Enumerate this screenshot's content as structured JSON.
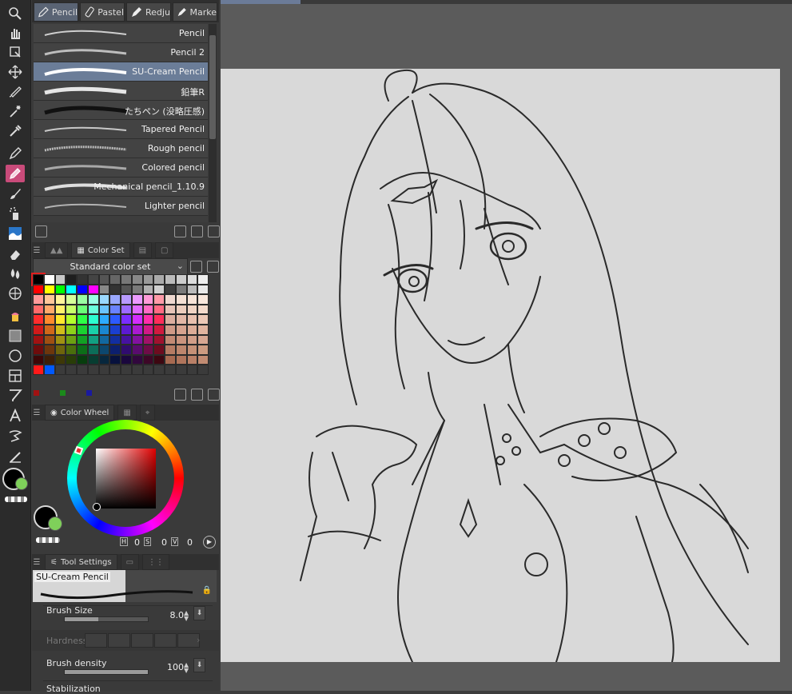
{
  "brush_tabs": [
    {
      "label": "Pencil",
      "selected": true
    },
    {
      "label": "Pastel",
      "selected": false
    },
    {
      "label": "Redju",
      "selected": false
    },
    {
      "label": "Marke",
      "selected": false
    }
  ],
  "brushes": [
    {
      "name": "Pencil",
      "selected": false
    },
    {
      "name": "Pencil 2",
      "selected": false
    },
    {
      "name": "SU-Cream Pencil",
      "selected": true
    },
    {
      "name": "鉛筆R",
      "selected": false
    },
    {
      "name": "たちペン (没略圧感)",
      "selected": false
    },
    {
      "name": "Tapered Pencil",
      "selected": false
    },
    {
      "name": "Rough pencil",
      "selected": false
    },
    {
      "name": "Colored pencil",
      "selected": false
    },
    {
      "name": "Mechanical pencil_1.10.9",
      "selected": false
    },
    {
      "name": "Lighter pencil",
      "selected": false
    }
  ],
  "color_set": {
    "tab_label": "Color Set",
    "selected_set": "Standard color set",
    "colors": [
      "#000000",
      "#ffffff",
      "#c8c8c8",
      "#1e1e1e",
      "#333333",
      "#444444",
      "#555555",
      "#666666",
      "#777777",
      "#888888",
      "#999999",
      "#aaaaaa",
      "#bbbbbb",
      "#cccccc",
      "#dddddd",
      "#eeeeee",
      "#ff0000",
      "#ffff00",
      "#00ff00",
      "#00ffff",
      "#0000ff",
      "#ff00ff",
      "#888888",
      "#333333",
      "#555555",
      "#7a7a7a",
      "#b0b0b0",
      "#d0d0d0",
      "#3e3e3e",
      "#7a7a7a",
      "#bbbbbb",
      "#e8e8e8",
      "#ff9a9a",
      "#ffc79a",
      "#fff59a",
      "#d6ff9a",
      "#9affa2",
      "#9affe4",
      "#9ad8ff",
      "#9aa8ff",
      "#b89aff",
      "#eb9aff",
      "#ff9ad8",
      "#ff9aa8",
      "#efd8d0",
      "#f4e0d4",
      "#f7e4d8",
      "#f8e7dc",
      "#ff6a6a",
      "#ffa96a",
      "#fff06a",
      "#c7ff6a",
      "#6aff78",
      "#6affdb",
      "#6ac4ff",
      "#6a82ff",
      "#9c6aff",
      "#e16aff",
      "#ff6ac4",
      "#ff6a82",
      "#e7c4b8",
      "#eccdbd",
      "#f0d4c4",
      "#f3dacb",
      "#ff2d2d",
      "#ff8a2d",
      "#ffe82d",
      "#b3ff2d",
      "#2dff47",
      "#2dffd0",
      "#2dabff",
      "#2d5aff",
      "#7a2dff",
      "#d32dff",
      "#ff2dab",
      "#ff2d5a",
      "#dcae9f",
      "#e2b7a6",
      "#e8c0ae",
      "#ecc8b6",
      "#d11a1a",
      "#d1681a",
      "#d1bd1a",
      "#8dd11a",
      "#1ad131",
      "#1ad1a9",
      "#1a87d1",
      "#1a3fd1",
      "#5c1ad1",
      "#aa1ad1",
      "#d11a87",
      "#d11a3f",
      "#cf9a87",
      "#d6a38f",
      "#dcac97",
      "#e1b49f",
      "#a01212",
      "#a04f12",
      "#a09112",
      "#6ca012",
      "#12a024",
      "#12a082",
      "#1268a0",
      "#122ea0",
      "#4612a0",
      "#8212a0",
      "#a01268",
      "#a0122e",
      "#c28a74",
      "#ca947e",
      "#d19e88",
      "#d7a792",
      "#6e0c0c",
      "#6e360c",
      "#6e640c",
      "#4a6e0c",
      "#0c6e18",
      "#0c6e59",
      "#0c476e",
      "#0c1f6e",
      "#300c6e",
      "#590c6e",
      "#6e0c47",
      "#6e0c1f",
      "#b57b63",
      "#bd866d",
      "#c59177",
      "#cc9b81",
      "#3d0707",
      "#3d1e07",
      "#3d3807",
      "#293d07",
      "#073d0d",
      "#073d31",
      "#07273d",
      "#07113d",
      "#1a073d",
      "#31073d",
      "#3d0727",
      "#3d0711",
      "#a76a51",
      "#b0755c",
      "#b98067",
      "#c18b72",
      "#ff1a1a",
      "#0059ff",
      "#3b3b3b",
      "#3b3b3b",
      "#3b3b3b",
      "#3b3b3b",
      "#3b3b3b",
      "#3b3b3b",
      "#3b3b3b",
      "#3b3b3b",
      "#3b3b3b",
      "#3b3b3b",
      "#3b3b3b",
      "#3b3b3b",
      "#3b3b3b",
      "#3b3b3b"
    ],
    "history_colors": [
      "#a01212",
      "#1b8a1b",
      "#1a1aa0"
    ]
  },
  "color_wheel": {
    "tab_label": "Color Wheel",
    "values": {
      "h": "0",
      "s": "0",
      "v": "0"
    },
    "main_color": "#000000",
    "sub_color": "#7fd05a"
  },
  "tool_settings": {
    "tab_label": "Tool Settings",
    "preview_name": "SU-Cream Pencil",
    "brush_size": {
      "label": "Brush Size",
      "value": "8.0",
      "fraction": 0.4
    },
    "hardness": {
      "label": "Hardness"
    },
    "brush_density": {
      "label": "Brush density",
      "value": "100",
      "fraction": 1.0
    },
    "stabilization": {
      "label": "Stabilization"
    }
  },
  "colors": {
    "accent_active_tool": "#c94b7a",
    "selected_brush": "#6b7d98",
    "paper": "#d9d9d9"
  }
}
